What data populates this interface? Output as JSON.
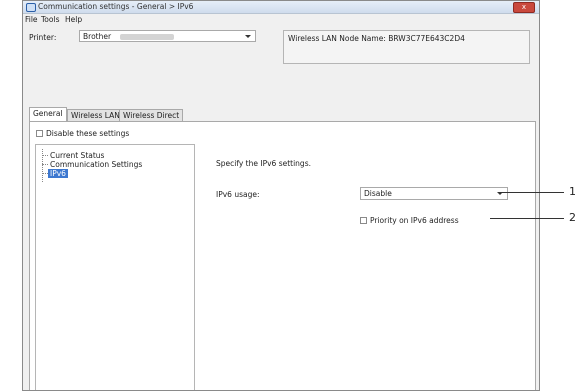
{
  "window": {
    "title": "Communication settings - General > IPv6",
    "close_label": "x"
  },
  "menu": [
    "File",
    "Tools",
    "Help"
  ],
  "printer": {
    "label": "Printer:",
    "value": "Brother"
  },
  "node_name": "Wireless LAN Node Name: BRW3C77E643C2D4",
  "tabs": [
    "General",
    "Wireless LAN",
    "Wireless Direct"
  ],
  "disable_settings_label": "Disable these settings",
  "tree": {
    "items": [
      "Current Status",
      "Communication Settings",
      "IPv6"
    ],
    "selected": "IPv6"
  },
  "main": {
    "description": "Specify the IPv6 settings.",
    "ipv6_usage_label": "IPv6 usage:",
    "ipv6_usage_value": "Disable",
    "priority_label": "Priority on IPv6 address"
  },
  "callouts": [
    "1",
    "2"
  ],
  "colors": {
    "selection": "#3d78d0",
    "close_button": "#c9483d"
  }
}
